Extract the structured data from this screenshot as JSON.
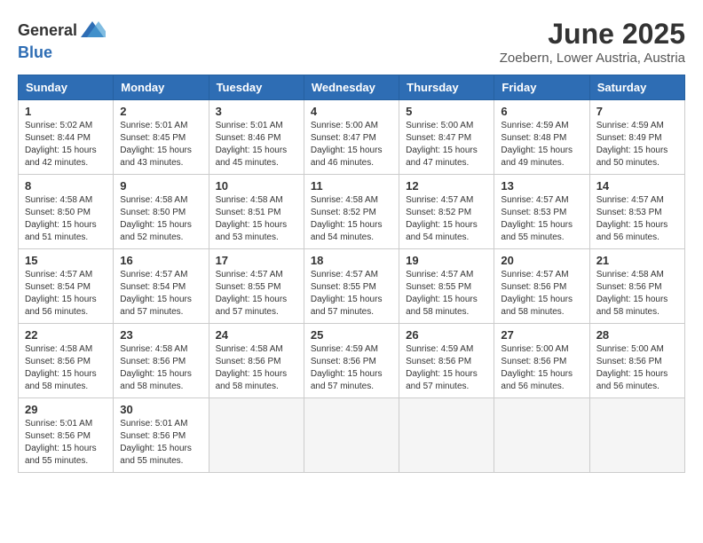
{
  "header": {
    "logo_line1": "General",
    "logo_line2": "Blue",
    "month_year": "June 2025",
    "location": "Zoebern, Lower Austria, Austria"
  },
  "weekdays": [
    "Sunday",
    "Monday",
    "Tuesday",
    "Wednesday",
    "Thursday",
    "Friday",
    "Saturday"
  ],
  "weeks": [
    [
      {
        "day": "1",
        "sunrise": "5:02 AM",
        "sunset": "8:44 PM",
        "daylight": "15 hours and 42 minutes."
      },
      {
        "day": "2",
        "sunrise": "5:01 AM",
        "sunset": "8:45 PM",
        "daylight": "15 hours and 43 minutes."
      },
      {
        "day": "3",
        "sunrise": "5:01 AM",
        "sunset": "8:46 PM",
        "daylight": "15 hours and 45 minutes."
      },
      {
        "day": "4",
        "sunrise": "5:00 AM",
        "sunset": "8:47 PM",
        "daylight": "15 hours and 46 minutes."
      },
      {
        "day": "5",
        "sunrise": "5:00 AM",
        "sunset": "8:47 PM",
        "daylight": "15 hours and 47 minutes."
      },
      {
        "day": "6",
        "sunrise": "4:59 AM",
        "sunset": "8:48 PM",
        "daylight": "15 hours and 49 minutes."
      },
      {
        "day": "7",
        "sunrise": "4:59 AM",
        "sunset": "8:49 PM",
        "daylight": "15 hours and 50 minutes."
      }
    ],
    [
      {
        "day": "8",
        "sunrise": "4:58 AM",
        "sunset": "8:50 PM",
        "daylight": "15 hours and 51 minutes."
      },
      {
        "day": "9",
        "sunrise": "4:58 AM",
        "sunset": "8:50 PM",
        "daylight": "15 hours and 52 minutes."
      },
      {
        "day": "10",
        "sunrise": "4:58 AM",
        "sunset": "8:51 PM",
        "daylight": "15 hours and 53 minutes."
      },
      {
        "day": "11",
        "sunrise": "4:58 AM",
        "sunset": "8:52 PM",
        "daylight": "15 hours and 54 minutes."
      },
      {
        "day": "12",
        "sunrise": "4:57 AM",
        "sunset": "8:52 PM",
        "daylight": "15 hours and 54 minutes."
      },
      {
        "day": "13",
        "sunrise": "4:57 AM",
        "sunset": "8:53 PM",
        "daylight": "15 hours and 55 minutes."
      },
      {
        "day": "14",
        "sunrise": "4:57 AM",
        "sunset": "8:53 PM",
        "daylight": "15 hours and 56 minutes."
      }
    ],
    [
      {
        "day": "15",
        "sunrise": "4:57 AM",
        "sunset": "8:54 PM",
        "daylight": "15 hours and 56 minutes."
      },
      {
        "day": "16",
        "sunrise": "4:57 AM",
        "sunset": "8:54 PM",
        "daylight": "15 hours and 57 minutes."
      },
      {
        "day": "17",
        "sunrise": "4:57 AM",
        "sunset": "8:55 PM",
        "daylight": "15 hours and 57 minutes."
      },
      {
        "day": "18",
        "sunrise": "4:57 AM",
        "sunset": "8:55 PM",
        "daylight": "15 hours and 57 minutes."
      },
      {
        "day": "19",
        "sunrise": "4:57 AM",
        "sunset": "8:55 PM",
        "daylight": "15 hours and 58 minutes."
      },
      {
        "day": "20",
        "sunrise": "4:57 AM",
        "sunset": "8:56 PM",
        "daylight": "15 hours and 58 minutes."
      },
      {
        "day": "21",
        "sunrise": "4:58 AM",
        "sunset": "8:56 PM",
        "daylight": "15 hours and 58 minutes."
      }
    ],
    [
      {
        "day": "22",
        "sunrise": "4:58 AM",
        "sunset": "8:56 PM",
        "daylight": "15 hours and 58 minutes."
      },
      {
        "day": "23",
        "sunrise": "4:58 AM",
        "sunset": "8:56 PM",
        "daylight": "15 hours and 58 minutes."
      },
      {
        "day": "24",
        "sunrise": "4:58 AM",
        "sunset": "8:56 PM",
        "daylight": "15 hours and 58 minutes."
      },
      {
        "day": "25",
        "sunrise": "4:59 AM",
        "sunset": "8:56 PM",
        "daylight": "15 hours and 57 minutes."
      },
      {
        "day": "26",
        "sunrise": "4:59 AM",
        "sunset": "8:56 PM",
        "daylight": "15 hours and 57 minutes."
      },
      {
        "day": "27",
        "sunrise": "5:00 AM",
        "sunset": "8:56 PM",
        "daylight": "15 hours and 56 minutes."
      },
      {
        "day": "28",
        "sunrise": "5:00 AM",
        "sunset": "8:56 PM",
        "daylight": "15 hours and 56 minutes."
      }
    ],
    [
      {
        "day": "29",
        "sunrise": "5:01 AM",
        "sunset": "8:56 PM",
        "daylight": "15 hours and 55 minutes."
      },
      {
        "day": "30",
        "sunrise": "5:01 AM",
        "sunset": "8:56 PM",
        "daylight": "15 hours and 55 minutes."
      },
      null,
      null,
      null,
      null,
      null
    ]
  ]
}
